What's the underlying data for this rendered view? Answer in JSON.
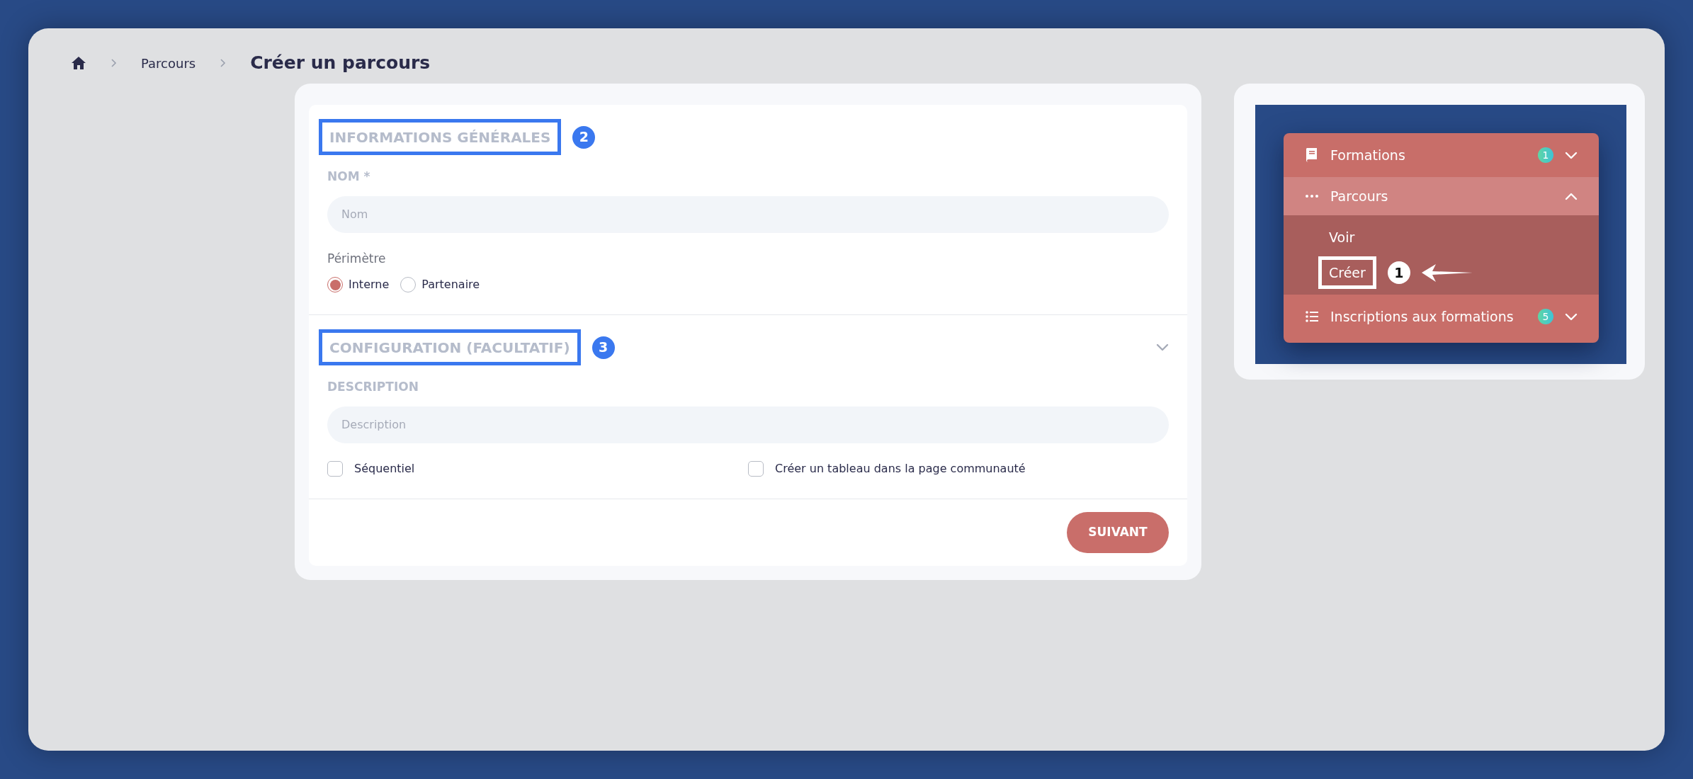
{
  "breadcrumb": {
    "items": [
      {
        "label": "Parcours"
      }
    ],
    "current": "Créer un parcours"
  },
  "sections": [
    {
      "title": "INFORMATIONS GÉNÉRALES",
      "highlighted": true,
      "callout": "2",
      "collapsible": false,
      "fields": [
        {
          "kind": "input",
          "label": "NOM *",
          "placeholder": "Nom"
        },
        {
          "kind": "radio",
          "label": "Périmètre",
          "options": [
            {
              "label": "Interne",
              "selected": true
            },
            {
              "label": "Partenaire",
              "selected": false
            }
          ]
        }
      ]
    },
    {
      "title": "CONFIGURATION (FACULTATIF)",
      "highlighted": true,
      "callout": "3",
      "collapsible": true,
      "fields": [
        {
          "kind": "input",
          "label": "DESCRIPTION",
          "placeholder": "Description"
        },
        {
          "kind": "checkboxes",
          "options": [
            {
              "label": "Séquentiel",
              "checked": false
            },
            {
              "label": "Créer un tableau dans la page communauté",
              "checked": false
            }
          ]
        }
      ]
    }
  ],
  "submit": "SUIVANT",
  "menu_preview": {
    "items": [
      {
        "label": "Formations",
        "badge": "1",
        "expanded": false
      },
      {
        "label": "Parcours",
        "expanded": true,
        "children": [
          {
            "label": "Voir",
            "highlighted": false
          },
          {
            "label": "Créer",
            "highlighted": true,
            "callout": "1"
          }
        ]
      },
      {
        "label": "Inscriptions aux formations",
        "badge": "5",
        "expanded": false
      }
    ]
  }
}
